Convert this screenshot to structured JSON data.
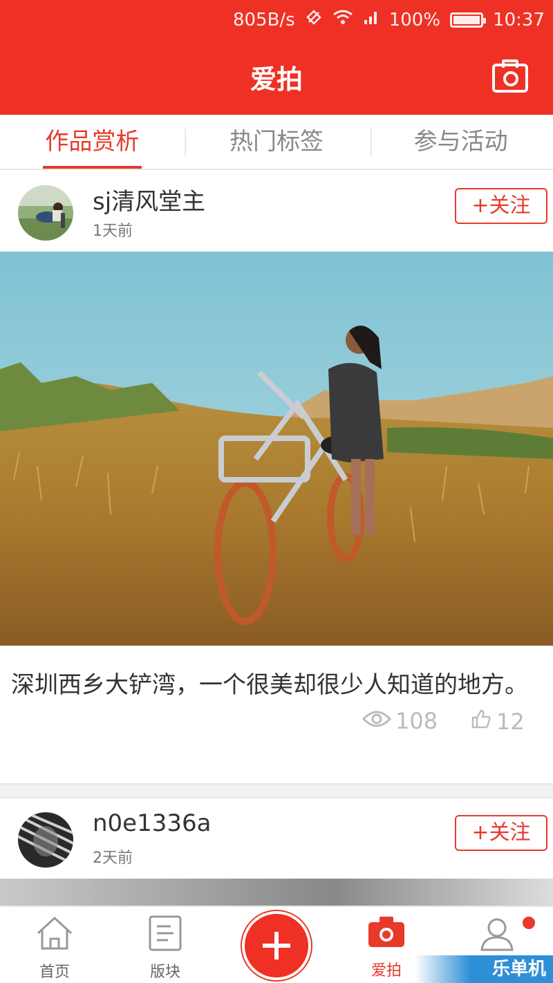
{
  "status": {
    "speed": "805B/s",
    "battery": "100%",
    "time": "10:37"
  },
  "header": {
    "title": "爱拍"
  },
  "tabs": [
    {
      "label": "作品赏析",
      "active": true
    },
    {
      "label": "热门标签",
      "active": false
    },
    {
      "label": "参与活动",
      "active": false
    }
  ],
  "posts": [
    {
      "username": "sj清风堂主",
      "time": "1天前",
      "follow_label": "+关注",
      "caption": "深圳西乡大铲湾，一个很美却很少人知道的地方。",
      "views": "108",
      "likes": "12"
    },
    {
      "username": "n0e1336a",
      "time": "2天前",
      "follow_label": "+关注"
    }
  ],
  "bottom_nav": [
    {
      "label": "首页"
    },
    {
      "label": "版块"
    },
    {
      "label": ""
    },
    {
      "label": "爱拍",
      "active": true
    },
    {
      "label": ""
    }
  ],
  "watermark": "乐单机",
  "colors": {
    "brand": "#ee3124",
    "accent": "#e8392b"
  }
}
